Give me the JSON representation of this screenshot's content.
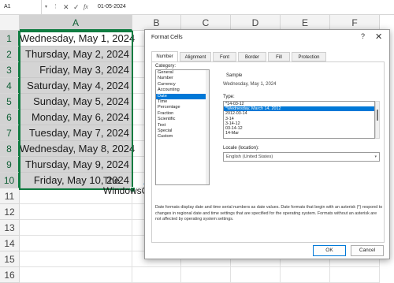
{
  "formula_bar": {
    "name_box": "A1",
    "content": "01-05-2024",
    "fx_label": "fx",
    "cancel_glyph": "✕",
    "enter_glyph": "✓",
    "dots_glyph": "⋮",
    "namebox_arrow": "▾"
  },
  "sheet": {
    "columns": [
      "A",
      "B",
      "C",
      "D",
      "E",
      "F"
    ],
    "selected_column": "A",
    "rows": [
      "1",
      "2",
      "3",
      "4",
      "5",
      "6",
      "7",
      "8",
      "9",
      "10",
      "11",
      "12",
      "13",
      "14",
      "15",
      "16"
    ],
    "cells_A": [
      "Wednesday, May 1, 2024",
      "Thursday, May 2, 2024",
      "Friday, May 3, 2024",
      "Saturday, May 4, 2024",
      "Sunday, May 5, 2024",
      "Monday, May 6, 2024",
      "Tuesday, May 7, 2024",
      "Wednesday, May 8, 2024",
      "Thursday, May 9, 2024",
      "Friday, May 10, 2024"
    ],
    "selection_color": "#107c41"
  },
  "watermark": {
    "line1": "The",
    "line2": "WindowsClub"
  },
  "dialog": {
    "title": "Format Cells",
    "help": "?",
    "close": "✕",
    "tabs": [
      "Number",
      "Alignment",
      "Font",
      "Border",
      "Fill",
      "Protection"
    ],
    "active_tab": "Number",
    "category_label": "Category:",
    "categories": [
      "General",
      "Number",
      "Currency",
      "Accounting",
      "Date",
      "Time",
      "Percentage",
      "Fraction",
      "Scientific",
      "Text",
      "Special",
      "Custom"
    ],
    "selected_category": "Date",
    "sample_label": "Sample",
    "sample_value": "Wednesday, May 1, 2024",
    "type_label": "Type:",
    "types": [
      "*14-03-12",
      "*Wednesday, March 14, 2012",
      "2012-03-14",
      "3-14",
      "3-14-12",
      "03-14-12",
      "14-Mar"
    ],
    "selected_type": "*Wednesday, March 14, 2012",
    "locale_label": "Locale (location):",
    "locale_value": "English (United States)",
    "locale_arrow": "▾",
    "description": "Date formats display date and time serial numbers as date values.  Date formats that begin with an asterisk (*) respond to changes in regional date and time settings that are specified for the operating system. Formats without an asterisk are not affected by operating system settings.",
    "ok_label": "OK",
    "cancel_label": "Cancel",
    "accent_color": "#0078d7"
  }
}
